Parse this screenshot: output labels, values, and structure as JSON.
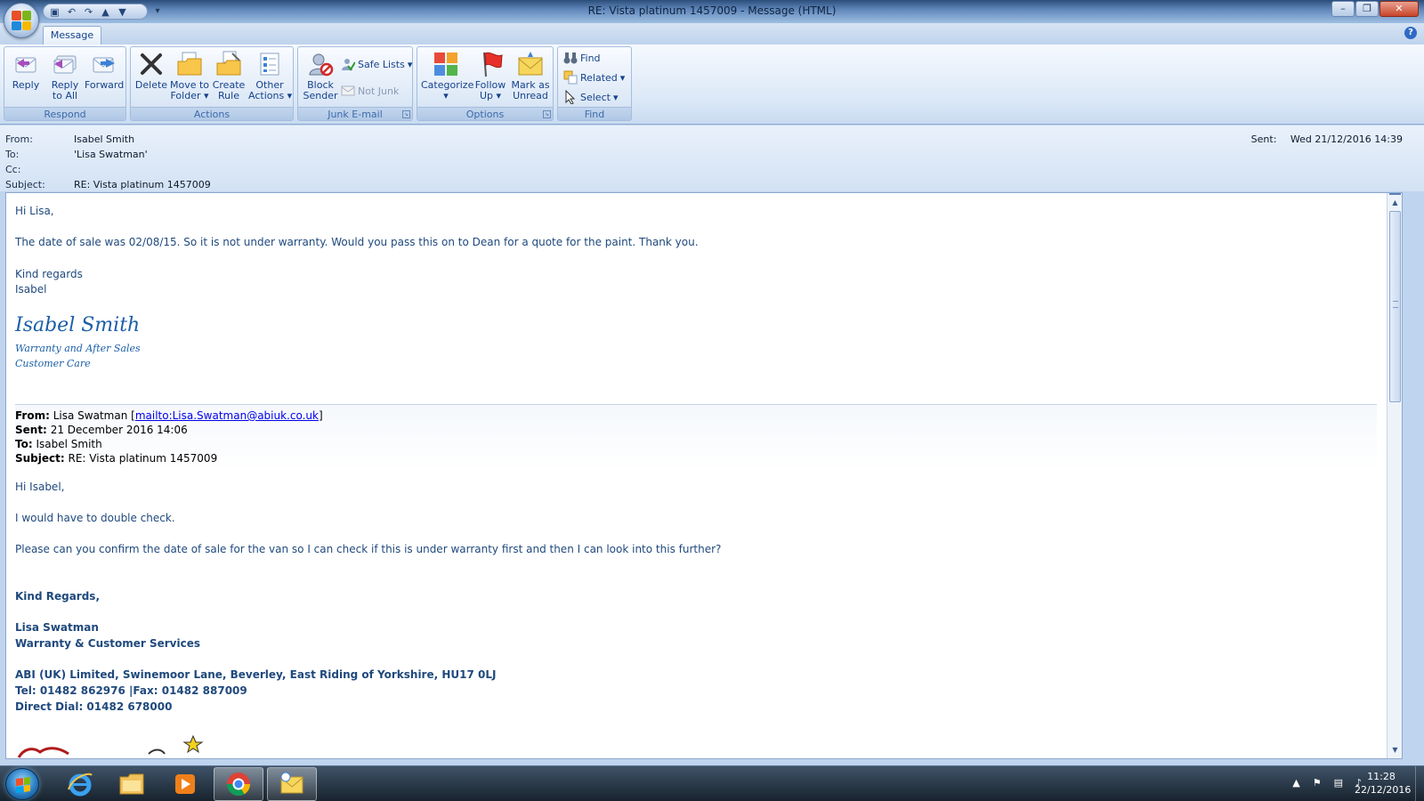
{
  "window": {
    "title": "RE: Vista platinum 1457009 - Message (HTML)",
    "minimize": "–",
    "restore": "❐",
    "close": "✕"
  },
  "tabs": {
    "message": "Message"
  },
  "ribbon": {
    "respond": {
      "label": "Respond",
      "reply": "Reply",
      "reply_all_1": "Reply",
      "reply_all_2": "to All",
      "forward": "Forward"
    },
    "actions": {
      "label": "Actions",
      "delete": "Delete",
      "move_1": "Move to",
      "move_2": "Folder",
      "rule_1": "Create",
      "rule_2": "Rule",
      "other_1": "Other",
      "other_2": "Actions"
    },
    "junk": {
      "label": "Junk E-mail",
      "block_1": "Block",
      "block_2": "Sender",
      "safe_lists": "Safe Lists",
      "not_junk": "Not Junk"
    },
    "options": {
      "label": "Options",
      "categorize": "Categorize",
      "follow_1": "Follow",
      "follow_2": "Up",
      "mark_1": "Mark as",
      "mark_2": "Unread"
    },
    "find": {
      "label": "Find",
      "find": "Find",
      "related": "Related",
      "select": "Select"
    }
  },
  "header": {
    "from_label": "From:",
    "from_value": "Isabel Smith",
    "to_label": "To:",
    "to_value": "'Lisa Swatman'",
    "cc_label": "Cc:",
    "cc_value": "",
    "subject_label": "Subject:",
    "subject_value": "RE: Vista platinum 1457009",
    "sent_label": "Sent:",
    "sent_value": "Wed 21/12/2016 14:39"
  },
  "body": {
    "greeting": "Hi Lisa,",
    "para1": "The date of sale was 02/08/15. So it is not under warranty. Would you pass this on to Dean for a quote for the paint. Thank you.",
    "regards": "Kind regards",
    "name_short": "Isabel",
    "sig_name": "Isabel Smith",
    "sig_line1": "Warranty and After Sales",
    "sig_line2": "Customer Care",
    "quote": {
      "from_label": "From:",
      "from_value": "Lisa Swatman [",
      "from_link": "mailto:Lisa.Swatman@abiuk.co.uk",
      "from_close": "]",
      "sent_label": "Sent:",
      "sent_value": "21 December 2016 14:06",
      "to_label": "To:",
      "to_value": "Isabel Smith",
      "subject_label": "Subject:",
      "subject_value": "RE: Vista platinum 1457009"
    },
    "q_greeting": "Hi Isabel,",
    "q_para1": "I would have to double check.",
    "q_para2": "Please can you confirm the date of sale for the van so I can check if this is under warranty first and then I can look into this further?",
    "q_regards": "Kind Regards,",
    "q_name": "Lisa Swatman",
    "q_title": "Warranty & Customer Services",
    "q_address": "ABI (UK) Limited, Swinemoor Lane, Beverley, East Riding of Yorkshire, HU17 0LJ",
    "q_tel": "Tel: 01482 862976 |Fax: 01482 887009",
    "q_direct": "Direct Dial: 01482 678000"
  },
  "taskbar": {
    "time": "11:28",
    "date": "22/12/2016"
  }
}
